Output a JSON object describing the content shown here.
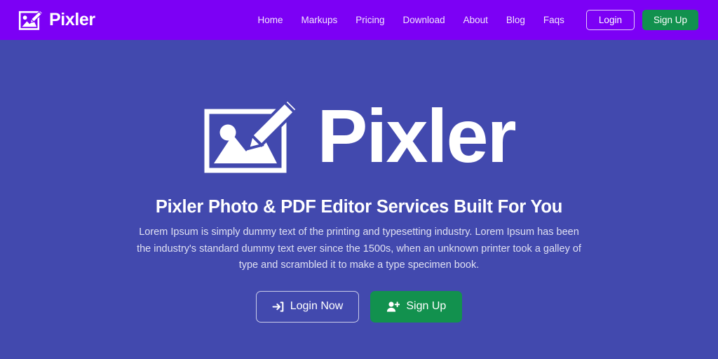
{
  "theme": {
    "header_bg": "#7C00F5",
    "hero_bg": "#4249AE",
    "accent_green": "#12914E",
    "text_light": "#FFFFFF",
    "paragraph_color": "#DFE0F2"
  },
  "header": {
    "brand": {
      "name": "Pixler",
      "icon": "image-pencil-logo-icon"
    },
    "nav": [
      {
        "label": "Home"
      },
      {
        "label": "Markups"
      },
      {
        "label": "Pricing"
      },
      {
        "label": "Download"
      },
      {
        "label": "About"
      },
      {
        "label": "Blog"
      },
      {
        "label": "Faqs"
      }
    ],
    "actions": {
      "login_label": "Login",
      "signup_label": "Sign Up"
    }
  },
  "hero": {
    "logo": {
      "icon": "image-pencil-logo-icon",
      "wordmark": "Pixler"
    },
    "headline": "Pixler Photo & PDF Editor Services Built For You",
    "paragraph": "Lorem Ipsum is simply dummy text of the printing and typesetting industry. Lorem Ipsum has been the industry's standard dummy text ever since the 1500s, when an unknown printer took a galley of type and scrambled it to make a type specimen book.",
    "cta": {
      "login_label": "Login Now",
      "login_icon": "sign-in-arrow-icon",
      "signup_label": "Sign Up",
      "signup_icon": "user-plus-icon"
    }
  }
}
